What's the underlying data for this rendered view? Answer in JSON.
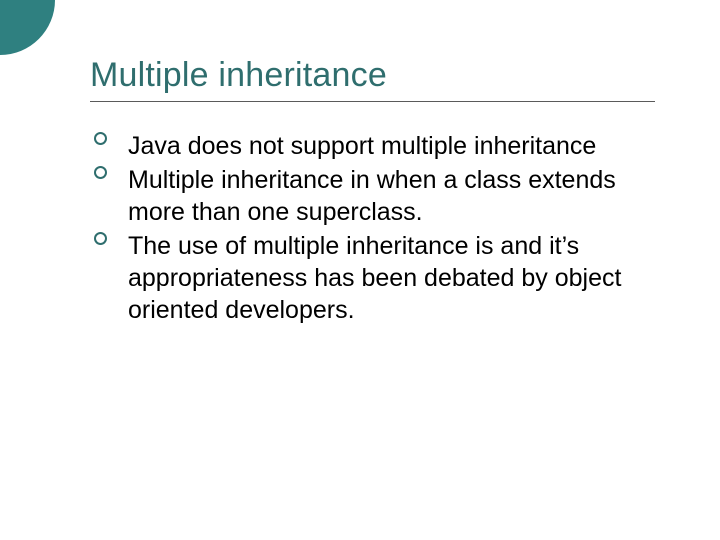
{
  "slide": {
    "title": "Multiple inheritance",
    "bullets": [
      "Java does not support multiple inheritance",
      "Multiple inheritance in when a class extends more than one superclass.",
      "The use of multiple inheritance is and it’s appropriateness has been debated by object oriented developers."
    ]
  }
}
